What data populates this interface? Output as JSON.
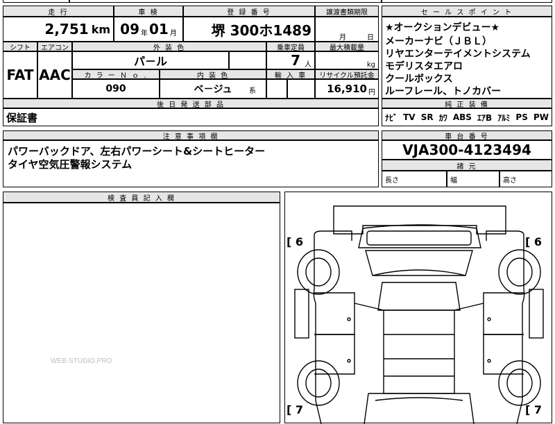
{
  "header": {
    "mileage_label": "走 行",
    "shaken_label": "車 検",
    "registration_label": "登 録 番 号",
    "transfer_label": "譲渡書類期限",
    "selling_points_label": "セ ー ル ス ポ イ ン ト"
  },
  "values": {
    "mileage": "2,751",
    "mileage_unit": "km",
    "shaken_year": "09",
    "shaken_year_unit": "年",
    "shaken_month": "01",
    "shaken_month_unit": "月",
    "registration": "堺 300ホ1489",
    "transfer_month_unit": "月",
    "transfer_day_unit": "日"
  },
  "selling_points": [
    "★オークションデビュー★",
    "メーカーナビ（ＪＢＬ）",
    "リヤエンターテイメントシステム",
    "モデリスタエアロ",
    "クールボックス",
    "ルーフレール、トノカバー"
  ],
  "row2": {
    "shift_label": "シフト",
    "ac_label": "エアコン",
    "exterior_label": "外 装 色",
    "capacity_label": "乗車定員",
    "max_load_label": "最大積載量",
    "shift_value": "FAT",
    "ac_value": "AAC",
    "exterior_value": "パ－ル",
    "capacity_value": "7",
    "capacity_unit": "人",
    "max_load_unit": "kg",
    "color_no_label": "カ ラ ー Ｎ ｏ .",
    "interior_label": "内 装 色",
    "import_label": "輸 入 車",
    "recycle_label": "リサイクル預託金",
    "color_no_value": "090",
    "interior_value": "ベ－ジュ",
    "interior_suffix": "系",
    "recycle_value": "16,910",
    "recycle_unit": "円"
  },
  "genuine": {
    "label": "純 正 装 備",
    "items": [
      "ﾅﾋﾞ",
      "TV",
      "SR",
      "ｶﾜ",
      "ABS",
      "ｴｱB",
      "ｱﾙﾐ",
      "PS",
      "PW"
    ]
  },
  "later_parts": {
    "label": "後 日 発 送 部 品",
    "value": "保証書"
  },
  "notes": {
    "label": "注 意 事 項 欄",
    "lines": [
      "パワーバックドア、左右パワーシート&シートヒーター",
      "タイヤ空気圧警報システム"
    ]
  },
  "chassis": {
    "label": "車 台 番 号",
    "value": "VJA300-4123494"
  },
  "specs": {
    "label": "諸 元",
    "length_label": "長さ",
    "width_label": "幅",
    "height_label": "高さ"
  },
  "inspector": {
    "label": "検 査 員 記 入 欄",
    "watermark": "WEB-STUDIO.PRO"
  },
  "diagram": {
    "top_left": "[ 6",
    "top_right": "[ 6",
    "bottom_left": "[ 7",
    "bottom_right": "[ 7"
  }
}
